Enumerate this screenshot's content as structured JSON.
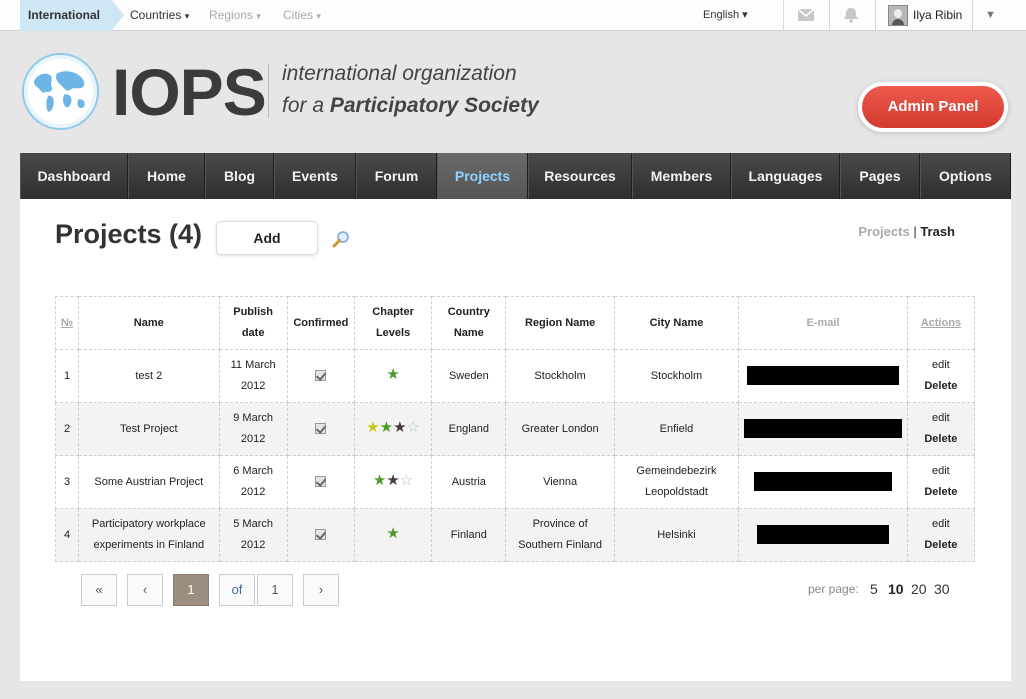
{
  "topbar": {
    "international": "International",
    "countries": "Countries",
    "regions": "Regions",
    "cities": "Cities",
    "caret": "▾",
    "language": "English ▾",
    "user_name": "Ilya Ribin",
    "user_caret": "▼"
  },
  "header": {
    "logo": "IOPS",
    "tagline_1": "international organization",
    "tagline_2_prefix": "for a ",
    "tagline_2_bold": "Participatory Society",
    "admin_panel": "Admin Panel"
  },
  "nav": {
    "items": [
      "Dashboard",
      "Home",
      "Blog",
      "Events",
      "Forum",
      "Projects",
      "Resources",
      "Members",
      "Languages",
      "Pages",
      "Options"
    ],
    "active": "Projects"
  },
  "page": {
    "title": "Projects (4)",
    "add": "Add",
    "view_projects": "Projects",
    "view_sep": " | ",
    "view_trash": "Trash"
  },
  "table": {
    "headers": {
      "num": "№",
      "name": "Name",
      "publish_1": "Publish",
      "publish_2": "date",
      "confirmed": "Confirmed",
      "chapter_1": "Chapter",
      "chapter_2": "Levels",
      "country_1": "Country",
      "country_2": "Name",
      "region": "Region Name",
      "city": "City Name",
      "email": "E-mail",
      "actions": "Actions"
    },
    "rows": [
      {
        "num": "1",
        "name_1": "test 2",
        "name_2": "",
        "date_1": "11 March",
        "date_2": "2012",
        "confirmed": true,
        "stars": [
          "green"
        ],
        "country": "Sweden",
        "region_1": "Stockholm",
        "region_2": "",
        "city_1": "Stockholm",
        "city_2": "",
        "edit": "edit",
        "delete": "Delete"
      },
      {
        "num": "2",
        "name_1": "Test Project",
        "name_2": "",
        "date_1": "9 March",
        "date_2": "2012",
        "confirmed": true,
        "stars": [
          "yellow",
          "green",
          "dark",
          "empty"
        ],
        "country": "England",
        "region_1": "Greater London",
        "region_2": "",
        "city_1": "Enfield",
        "city_2": "",
        "edit": "edit",
        "delete": "Delete"
      },
      {
        "num": "3",
        "name_1": "Some Austrian Project",
        "name_2": "",
        "date_1": "6 March",
        "date_2": "2012",
        "confirmed": true,
        "stars": [
          "green",
          "dark",
          "empty"
        ],
        "country": "Austria",
        "region_1": "Vienna",
        "region_2": "",
        "city_1": "Gemeindebezirk",
        "city_2": "Leopoldstadt",
        "edit": "edit",
        "delete": "Delete"
      },
      {
        "num": "4",
        "name_1": "Participatory workplace",
        "name_2": "experiments in Finland",
        "date_1": "5 March",
        "date_2": "2012",
        "confirmed": true,
        "stars": [
          "green"
        ],
        "country": "Finland",
        "region_1": "Province of",
        "region_2": "Southern Finland",
        "city_1": "Helsinki",
        "city_2": "",
        "edit": "edit",
        "delete": "Delete"
      }
    ]
  },
  "pager": {
    "first": "«",
    "prev": "‹",
    "current": "1",
    "of": "of",
    "total": "1",
    "next": "›",
    "per_page_label": "per page:",
    "per_page_options": [
      "5",
      "10",
      "20",
      "30"
    ],
    "per_page_selected": "10"
  },
  "colors": {
    "nav_active_text": "#8fd3ff",
    "admin_button": "#e04a3e",
    "breadcrumb_active": "#cfe6f5",
    "star_green": "#4e9a2b",
    "pager_current": "#9c8e7e"
  },
  "icons": {
    "mail": "mail-icon",
    "notifications": "bell-icon",
    "search": "search-icon",
    "logo": "globe-icon"
  }
}
